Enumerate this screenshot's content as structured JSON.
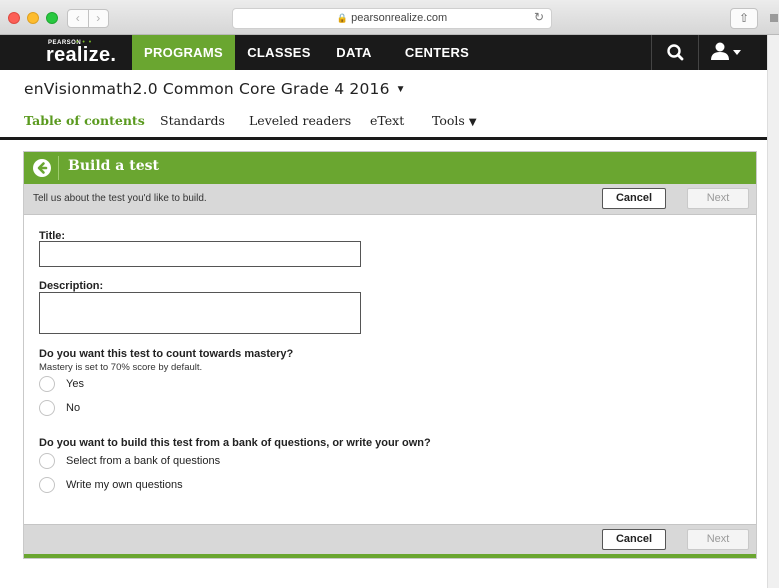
{
  "browser": {
    "url": "pearsonrealize.com",
    "back_glyph": "‹",
    "forward_glyph": "›",
    "reload_glyph": "↻",
    "share_glyph": "⇧"
  },
  "nav": {
    "logo_pearson": "PEARSON",
    "logo_name": "realize.",
    "logo_dots": "• • •",
    "items": [
      "PROGRAMS",
      "CLASSES",
      "DATA",
      "CENTERS"
    ],
    "active_color": "#6aa630",
    "icons": {
      "search": "search-icon",
      "user": "user-icon"
    }
  },
  "program": {
    "title": "enVisionmath2.0 Common Core Grade 4 2016",
    "caret": "▼",
    "tabs": [
      "Table of contents",
      "Standards",
      "Leveled readers",
      "eText",
      "Tools"
    ],
    "tools_caret": "▼"
  },
  "panel": {
    "title": "Build a test",
    "subtitle": "Tell us about the test you'd like to build.",
    "cancel": "Cancel",
    "next": "Next",
    "title_label": "Title:",
    "description_label": "Description:",
    "mastery_question": "Do you want this test to count towards mastery?",
    "mastery_help": "Mastery is set to 70% score by default.",
    "mastery_options": [
      "Yes",
      "No"
    ],
    "source_question": "Do you want to build this test from a bank of questions, or write your own?",
    "source_options": [
      "Select from a bank of questions",
      "Write my own questions"
    ],
    "accent_color": "#6aa630"
  }
}
